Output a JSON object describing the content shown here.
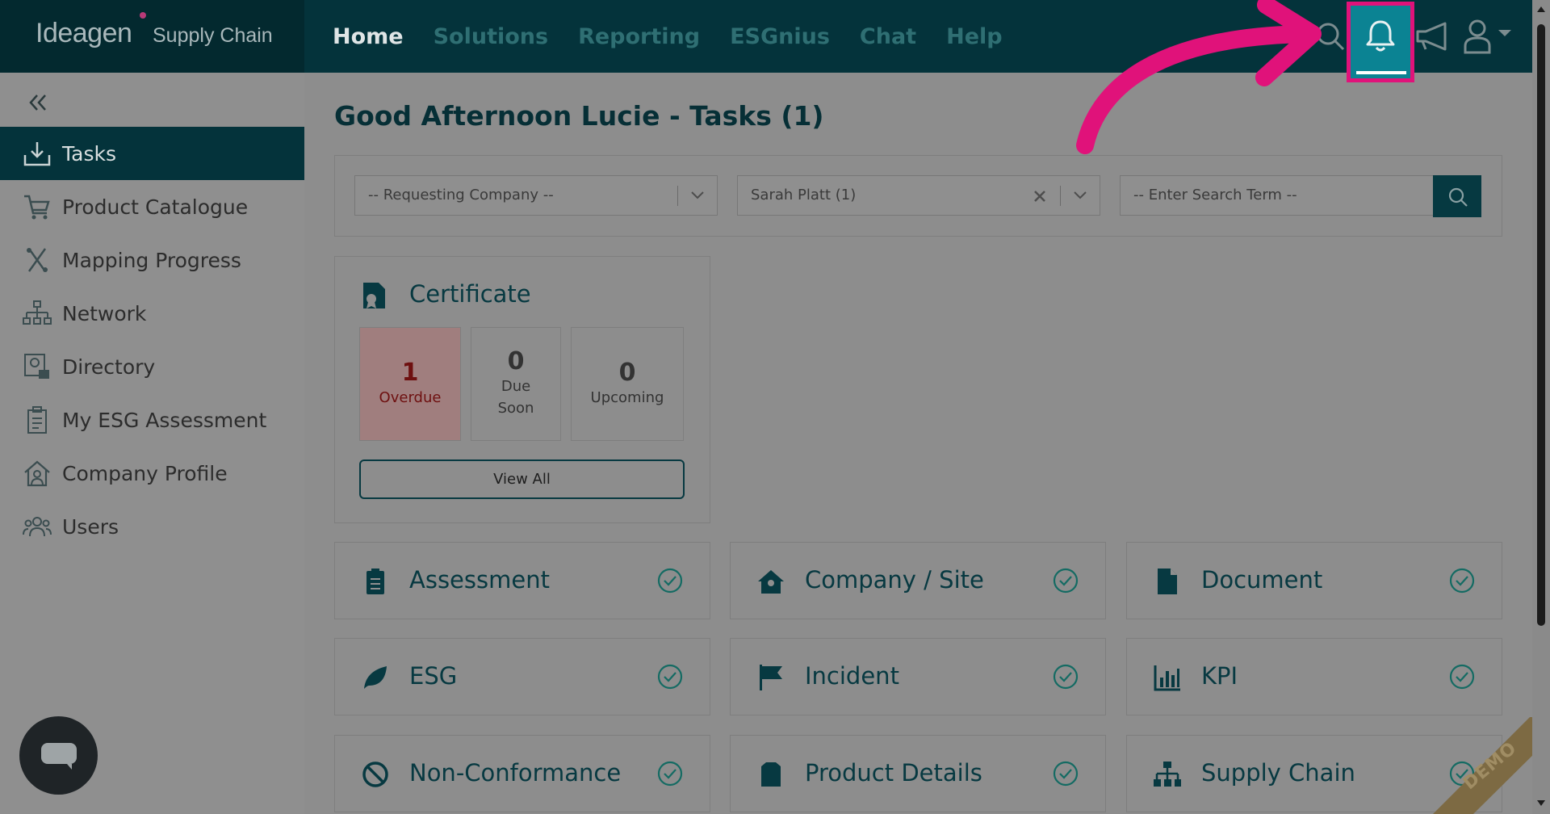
{
  "brand": {
    "logo_text": "Ideagen",
    "sub_text": "Supply Chain"
  },
  "nav": [
    {
      "label": "Home",
      "active": true
    },
    {
      "label": "Solutions"
    },
    {
      "label": "Reporting"
    },
    {
      "label": "ESGnius"
    },
    {
      "label": "Chat"
    },
    {
      "label": "Help"
    }
  ],
  "top_icons": [
    "search-icon",
    "bell-icon",
    "megaphone-icon",
    "user-icon"
  ],
  "sidebar": {
    "items": [
      {
        "label": "Tasks",
        "icon": "download-tray-icon",
        "active": true
      },
      {
        "label": "Product Catalogue",
        "icon": "cart-icon"
      },
      {
        "label": "Mapping Progress",
        "icon": "route-icon"
      },
      {
        "label": "Network",
        "icon": "network-icon"
      },
      {
        "label": "Directory",
        "icon": "directory-icon"
      },
      {
        "label": "My ESG Assessment",
        "icon": "clipboard-icon"
      },
      {
        "label": "Company Profile",
        "icon": "house-user-icon"
      },
      {
        "label": "Users",
        "icon": "users-icon"
      }
    ]
  },
  "main": {
    "greeting": "Good Afternoon Lucie - Tasks (1)",
    "filters": {
      "company_placeholder": "-- Requesting Company --",
      "assignee_value": "Sarah Platt (1)",
      "search_placeholder": "-- Enter Search Term --"
    },
    "certificate": {
      "title": "Certificate",
      "stats": [
        {
          "num": "1",
          "label": "Overdue"
        },
        {
          "num": "0",
          "label": "Due",
          "label2": "Soon"
        },
        {
          "num": "0",
          "label": "Upcoming"
        }
      ],
      "view_all": "View All"
    },
    "tiles": [
      {
        "label": "Assessment",
        "icon": "clipboard-list-icon"
      },
      {
        "label": "Company / Site",
        "icon": "house-icon"
      },
      {
        "label": "Document",
        "icon": "file-icon"
      },
      {
        "label": "ESG",
        "icon": "leaf-icon"
      },
      {
        "label": "Incident",
        "icon": "flag-icon"
      },
      {
        "label": "KPI",
        "icon": "bar-chart-icon"
      },
      {
        "label": "Non-Conformance",
        "icon": "ban-icon"
      },
      {
        "label": "Product Details",
        "icon": "box-icon"
      },
      {
        "label": "Supply Chain",
        "icon": "hierarchy-icon"
      }
    ]
  },
  "demo_ribbon": "DEMO",
  "colors": {
    "accent": "#04333b",
    "highlight": "#e0127a",
    "bell_active": "#0b8393",
    "overdue": "#6e1010"
  }
}
